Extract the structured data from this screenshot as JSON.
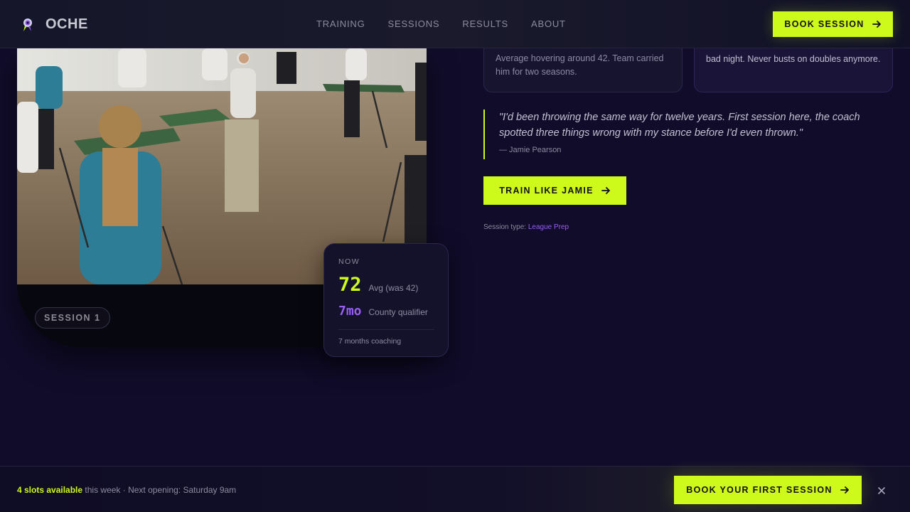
{
  "nav": {
    "brand": "OCHE",
    "links": [
      "TRAINING",
      "SESSIONS",
      "RESULTS",
      "ABOUT"
    ],
    "cta": "BOOK SESSION"
  },
  "feature": {
    "session_pill": "SESSION 1",
    "stats": {
      "label": "NOW",
      "primary_value": "72",
      "primary_note": "Avg (was 42)",
      "secondary_value": "7mo",
      "secondary_note": "County qualifier",
      "footer": "7 months coaching"
    }
  },
  "previous_cards": [
    {
      "text": "Average hovering around 42. Team carried him for two seasons."
    },
    {
      "text": "bad night. Never busts on doubles anymore."
    }
  ],
  "quote": {
    "text": "\"I'd been throwing the same way for twelve years. First session here, the coach spotted three things wrong with my stance before I'd even thrown.\"",
    "author": "— Jamie Pearson"
  },
  "train_cta": "TRAIN LIKE JAMIE",
  "session_type": {
    "label": "Session type:",
    "value": "League Prep"
  },
  "bottom_bar": {
    "slots_highlight": "4 slots available",
    "slots_rest": " this week · Next opening: Saturday 9am",
    "cta": "BOOK YOUR FIRST SESSION",
    "close_icon": "close-icon"
  },
  "colors": {
    "accent": "#cdfa1a",
    "secondary": "#9a5ef0",
    "background": "#110c2a"
  }
}
